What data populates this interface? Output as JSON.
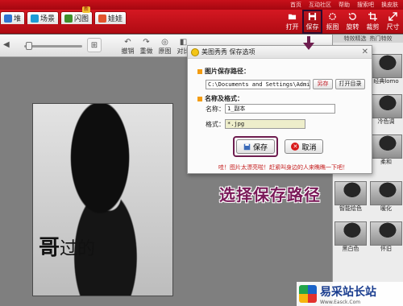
{
  "topmenu": [
    "首页",
    "互动社区",
    "帮助",
    "搜索吧",
    "换皮肤"
  ],
  "tabs": [
    {
      "label": "堆",
      "color": "#2f74d0"
    },
    {
      "label": "场景",
      "color": "#1d9bd6"
    },
    {
      "label": "闪图",
      "color": "#3f8f2a",
      "badge": "新"
    },
    {
      "label": "娃娃",
      "color": "#e2542d"
    }
  ],
  "right_tools": [
    {
      "label": "打开",
      "icon": "folder-icon"
    },
    {
      "label": "保存",
      "icon": "save-icon",
      "active": true
    },
    {
      "label": "抠图",
      "icon": "cutout-icon"
    },
    {
      "label": "旋转",
      "icon": "rotate-icon"
    },
    {
      "label": "裁剪",
      "icon": "crop-icon"
    },
    {
      "label": "尺寸",
      "icon": "resize-icon"
    }
  ],
  "edit_buttons": [
    "撤销",
    "重做",
    "原图",
    "对比"
  ],
  "effects": {
    "header_a": "特效精选",
    "header_b": "热门特效",
    "items": [
      "经典lomo",
      "冷色调",
      "柔和",
      "暖化",
      "智能绘色",
      "暖化",
      "黑白色",
      "怀旧"
    ]
  },
  "photo_caption_big": "哥",
  "photo_caption_small": "过的",
  "dialog": {
    "title": "美图秀秀 保存选项",
    "path_section": "图片保存路径：",
    "path_value": "C:\\Documents and Settings\\Admin",
    "browse_label": "另存",
    "open_dir_label": "打开目录",
    "name_section": "名称及格式：",
    "name_label": "名称：",
    "name_value": "1_副本",
    "format_label": "格式：",
    "format_value": "*.jpg",
    "save_label": "保存",
    "cancel_label": "取消",
    "tip": "哇！图片太漂亮啦！赶紧叫身边的人来瞧瞧一下吧！"
  },
  "annotation": "选择保存路径",
  "watermark": {
    "title": "易采站长站",
    "sub": "Www.Easck.Com"
  }
}
